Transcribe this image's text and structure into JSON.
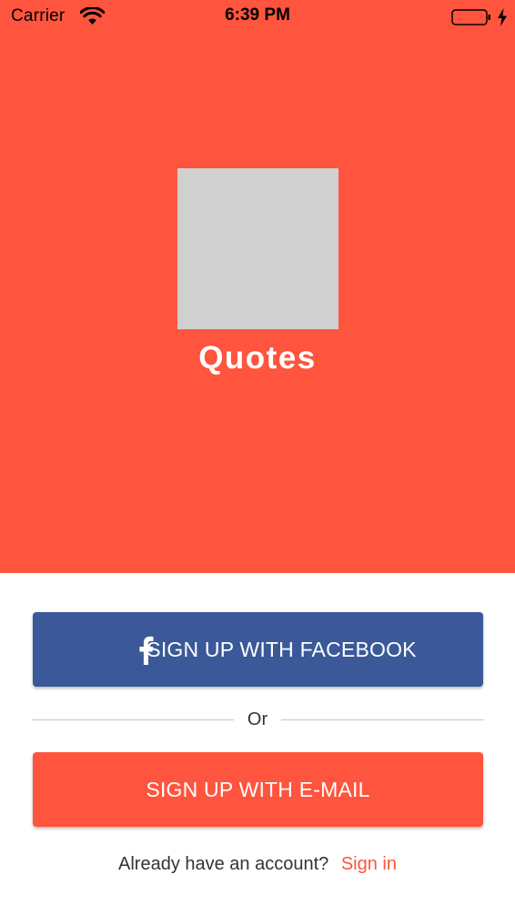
{
  "status_bar": {
    "carrier": "Carrier",
    "time": "6:39 PM",
    "icons": [
      "wifi-icon",
      "battery-icon",
      "charging-bolt-icon"
    ]
  },
  "hero": {
    "background_color": "#ff543d",
    "app_title": "Quotes",
    "logo": "image-placeholder"
  },
  "actions": {
    "facebook_label": "SIGN UP WITH FACEBOOK",
    "facebook_icon": "facebook-icon",
    "facebook_color": "#3b5999",
    "divider_text": "Or",
    "email_label": "SIGN UP WITH E-MAIL",
    "email_color": "#ff543d"
  },
  "footer": {
    "account_prompt": "Already have an account?",
    "signin_label": "Sign in",
    "link_color": "#ff543d"
  }
}
